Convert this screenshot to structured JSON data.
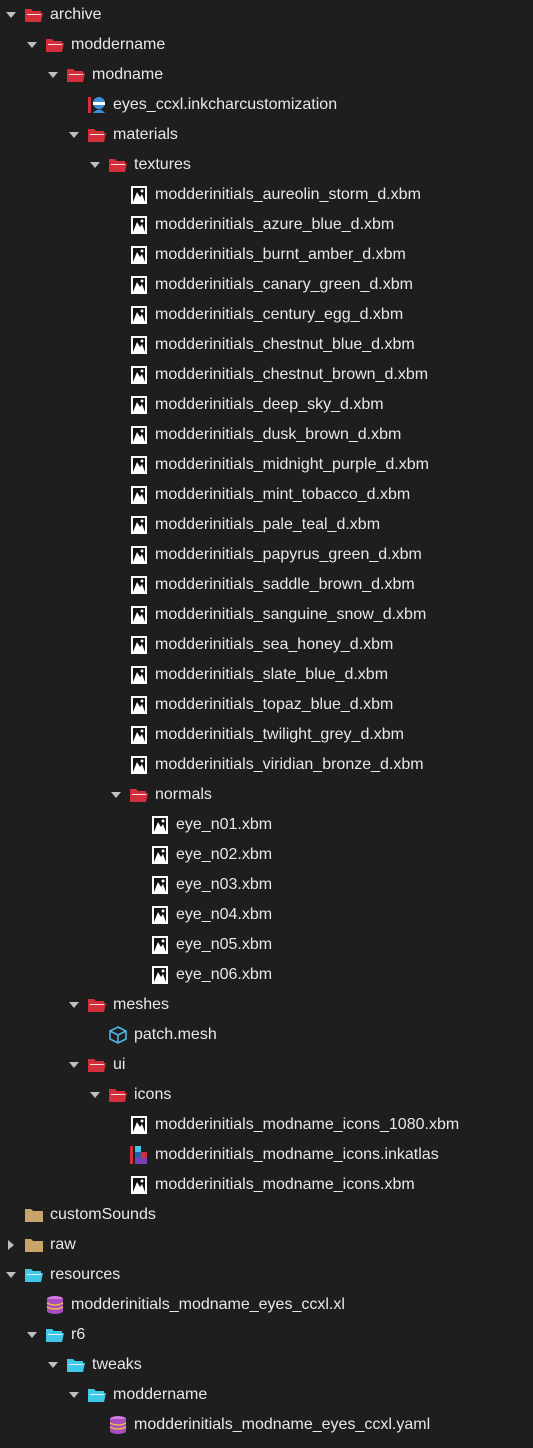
{
  "colors": {
    "background": "#1e1e1e",
    "folder_red": "#d32f3a",
    "folder_tan": "#c9a46a",
    "folder_cyan": "#3fc8e8",
    "text": "#e8e8e8"
  },
  "tree": [
    {
      "label": "archive",
      "icon": "folder-open-icon",
      "color": "red",
      "depth": 0,
      "twisty": "expanded"
    },
    {
      "label": "moddername",
      "icon": "folder-open-icon",
      "color": "red",
      "depth": 1,
      "twisty": "expanded"
    },
    {
      "label": "modname",
      "icon": "folder-open-icon",
      "color": "red",
      "depth": 2,
      "twisty": "expanded"
    },
    {
      "label": "eyes_ccxl.inkcharcustomization",
      "icon": "inkcharcustomization-icon",
      "depth": 3,
      "twisty": "none"
    },
    {
      "label": "materials",
      "icon": "folder-open-icon",
      "color": "red",
      "depth": 3,
      "twisty": "expanded"
    },
    {
      "label": "textures",
      "icon": "folder-open-icon",
      "color": "red",
      "depth": 4,
      "twisty": "expanded"
    },
    {
      "label": "modderinitials_aureolin_storm_d.xbm",
      "icon": "image-file-icon",
      "depth": 5,
      "twisty": "none"
    },
    {
      "label": "modderinitials_azure_blue_d.xbm",
      "icon": "image-file-icon",
      "depth": 5,
      "twisty": "none"
    },
    {
      "label": "modderinitials_burnt_amber_d.xbm",
      "icon": "image-file-icon",
      "depth": 5,
      "twisty": "none"
    },
    {
      "label": "modderinitials_canary_green_d.xbm",
      "icon": "image-file-icon",
      "depth": 5,
      "twisty": "none"
    },
    {
      "label": "modderinitials_century_egg_d.xbm",
      "icon": "image-file-icon",
      "depth": 5,
      "twisty": "none"
    },
    {
      "label": "modderinitials_chestnut_blue_d.xbm",
      "icon": "image-file-icon",
      "depth": 5,
      "twisty": "none"
    },
    {
      "label": "modderinitials_chestnut_brown_d.xbm",
      "icon": "image-file-icon",
      "depth": 5,
      "twisty": "none"
    },
    {
      "label": "modderinitials_deep_sky_d.xbm",
      "icon": "image-file-icon",
      "depth": 5,
      "twisty": "none"
    },
    {
      "label": "modderinitials_dusk_brown_d.xbm",
      "icon": "image-file-icon",
      "depth": 5,
      "twisty": "none"
    },
    {
      "label": "modderinitials_midnight_purple_d.xbm",
      "icon": "image-file-icon",
      "depth": 5,
      "twisty": "none"
    },
    {
      "label": "modderinitials_mint_tobacco_d.xbm",
      "icon": "image-file-icon",
      "depth": 5,
      "twisty": "none"
    },
    {
      "label": "modderinitials_pale_teal_d.xbm",
      "icon": "image-file-icon",
      "depth": 5,
      "twisty": "none"
    },
    {
      "label": "modderinitials_papyrus_green_d.xbm",
      "icon": "image-file-icon",
      "depth": 5,
      "twisty": "none"
    },
    {
      "label": "modderinitials_saddle_brown_d.xbm",
      "icon": "image-file-icon",
      "depth": 5,
      "twisty": "none"
    },
    {
      "label": "modderinitials_sanguine_snow_d.xbm",
      "icon": "image-file-icon",
      "depth": 5,
      "twisty": "none"
    },
    {
      "label": "modderinitials_sea_honey_d.xbm",
      "icon": "image-file-icon",
      "depth": 5,
      "twisty": "none"
    },
    {
      "label": "modderinitials_slate_blue_d.xbm",
      "icon": "image-file-icon",
      "depth": 5,
      "twisty": "none"
    },
    {
      "label": "modderinitials_topaz_blue_d.xbm",
      "icon": "image-file-icon",
      "depth": 5,
      "twisty": "none"
    },
    {
      "label": "modderinitials_twilight_grey_d.xbm",
      "icon": "image-file-icon",
      "depth": 5,
      "twisty": "none"
    },
    {
      "label": "modderinitials_viridian_bronze_d.xbm",
      "icon": "image-file-icon",
      "depth": 5,
      "twisty": "none"
    },
    {
      "label": "normals",
      "icon": "folder-open-icon",
      "color": "red",
      "depth": 5,
      "twisty": "expanded"
    },
    {
      "label": "eye_n01.xbm",
      "icon": "image-file-icon",
      "depth": 6,
      "twisty": "none"
    },
    {
      "label": "eye_n02.xbm",
      "icon": "image-file-icon",
      "depth": 6,
      "twisty": "none"
    },
    {
      "label": "eye_n03.xbm",
      "icon": "image-file-icon",
      "depth": 6,
      "twisty": "none"
    },
    {
      "label": "eye_n04.xbm",
      "icon": "image-file-icon",
      "depth": 6,
      "twisty": "none"
    },
    {
      "label": "eye_n05.xbm",
      "icon": "image-file-icon",
      "depth": 6,
      "twisty": "none"
    },
    {
      "label": "eye_n06.xbm",
      "icon": "image-file-icon",
      "depth": 6,
      "twisty": "none"
    },
    {
      "label": "meshes",
      "icon": "folder-open-icon",
      "color": "red",
      "depth": 3,
      "twisty": "expanded"
    },
    {
      "label": "patch.mesh",
      "icon": "mesh-cube-icon",
      "depth": 4,
      "twisty": "none"
    },
    {
      "label": "ui",
      "icon": "folder-open-icon",
      "color": "red",
      "depth": 3,
      "twisty": "expanded"
    },
    {
      "label": "icons",
      "icon": "folder-open-icon",
      "color": "red",
      "depth": 4,
      "twisty": "expanded"
    },
    {
      "label": "modderinitials_modname_icons_1080.xbm",
      "icon": "image-file-icon",
      "depth": 5,
      "twisty": "none"
    },
    {
      "label": "modderinitials_modname_icons.inkatlas",
      "icon": "inkatlas-icon",
      "depth": 5,
      "twisty": "none"
    },
    {
      "label": "modderinitials_modname_icons.xbm",
      "icon": "image-file-icon",
      "depth": 5,
      "twisty": "none"
    },
    {
      "label": "customSounds",
      "icon": "folder-icon",
      "color": "tan",
      "depth": 0,
      "twisty": "none"
    },
    {
      "label": "raw",
      "icon": "folder-icon",
      "color": "tan",
      "depth": 0,
      "twisty": "collapsed"
    },
    {
      "label": "resources",
      "icon": "folder-open-icon",
      "color": "cyan",
      "depth": 0,
      "twisty": "expanded"
    },
    {
      "label": "modderinitials_modname_eyes_ccxl.xl",
      "icon": "database-file-icon",
      "depth": 1,
      "twisty": "none"
    },
    {
      "label": "r6",
      "icon": "folder-open-icon",
      "color": "cyan",
      "depth": 1,
      "twisty": "expanded"
    },
    {
      "label": "tweaks",
      "icon": "folder-open-icon",
      "color": "cyan",
      "depth": 2,
      "twisty": "expanded"
    },
    {
      "label": "moddername",
      "icon": "folder-open-icon",
      "color": "cyan",
      "depth": 3,
      "twisty": "expanded"
    },
    {
      "label": "modderinitials_modname_eyes_ccxl.yaml",
      "icon": "database-file-icon",
      "depth": 4,
      "twisty": "none"
    }
  ]
}
